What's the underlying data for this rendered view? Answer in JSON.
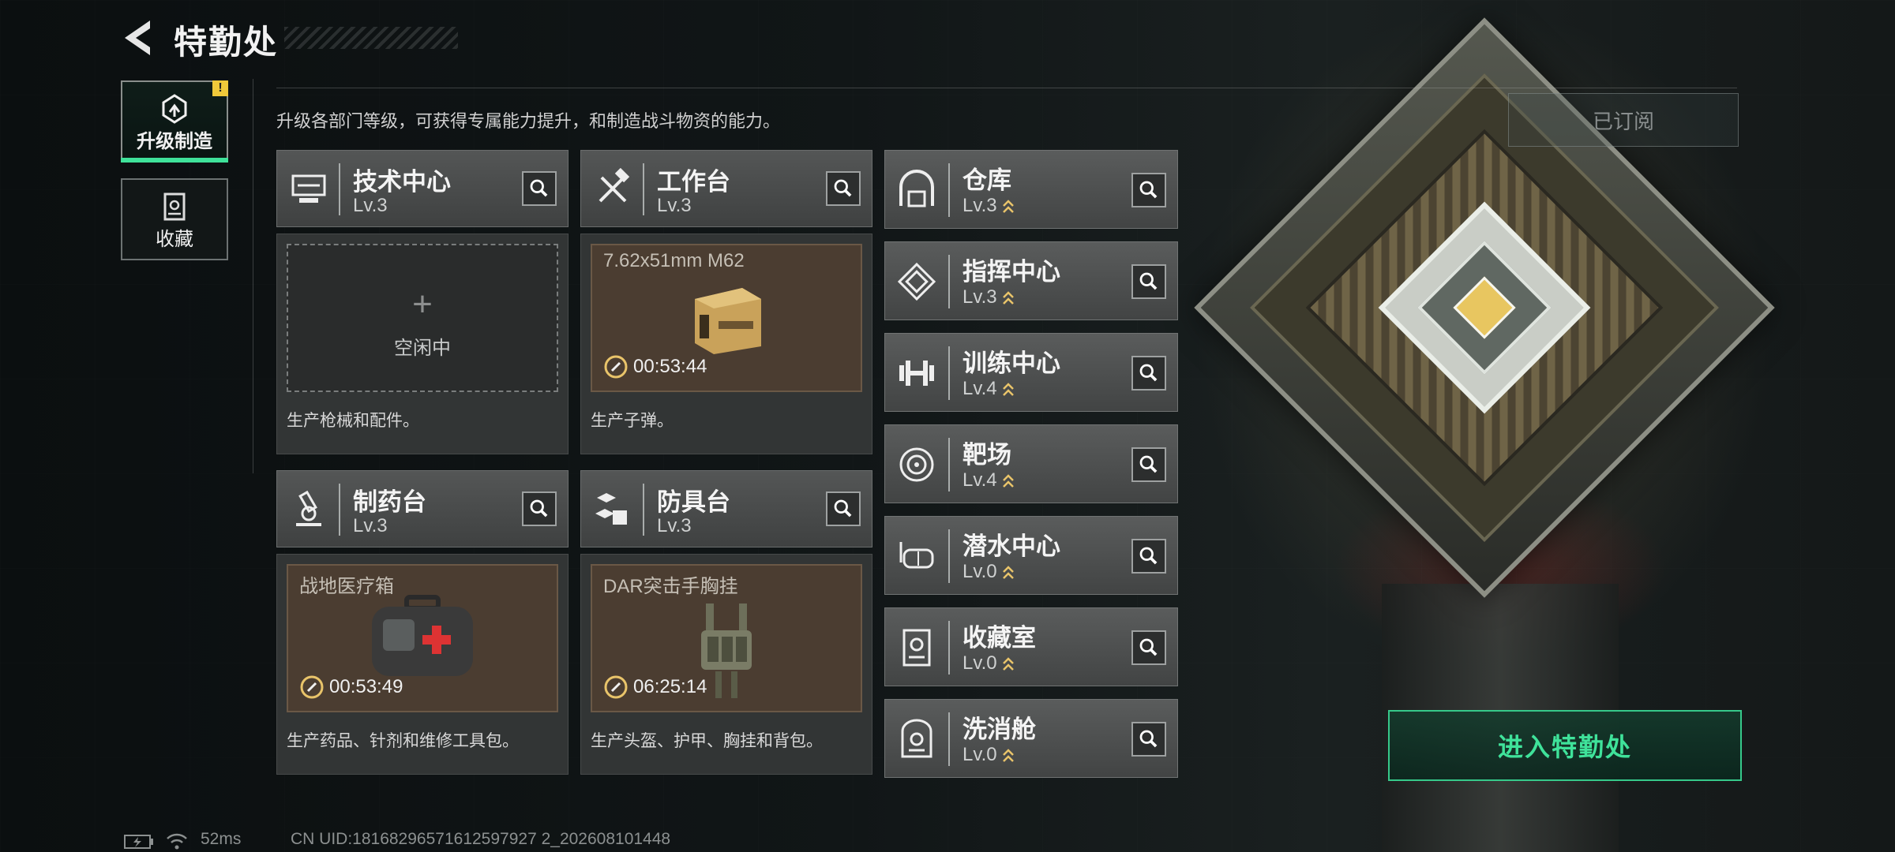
{
  "header": {
    "title": "特勤处"
  },
  "sidebar": {
    "items": [
      {
        "label": "升级制造",
        "active": true,
        "badge": "!"
      },
      {
        "label": "收藏",
        "active": false
      }
    ]
  },
  "subtitle": "升级各部门等级，可获得专属能力提升，和制造战斗物资的能力。",
  "subscribed_button": "已订阅",
  "cards": [
    {
      "name": "技术中心",
      "level": "Lv.3",
      "icon": "tech-center-icon",
      "slot": {
        "state": "idle",
        "plus": "+",
        "label": "空闲中"
      },
      "desc": "生产枪械和配件。"
    },
    {
      "name": "工作台",
      "level": "Lv.3",
      "icon": "hammer-wrench-icon",
      "slot": {
        "state": "producing",
        "item": "7.62x51mm M62",
        "time": "00:53:44",
        "item_icon": "ammo-box-icon"
      },
      "desc": "生产子弹。"
    },
    {
      "name": "制药台",
      "level": "Lv.3",
      "icon": "microscope-icon",
      "slot": {
        "state": "producing",
        "item": "战地医疗箱",
        "time": "00:53:49",
        "item_icon": "medkit-icon"
      },
      "desc": "生产药品、针剂和维修工具包。"
    },
    {
      "name": "防具台",
      "level": "Lv.3",
      "icon": "armor-blocks-icon",
      "slot": {
        "state": "producing",
        "item": "DAR突击手胸挂",
        "time": "06:25:14",
        "item_icon": "chest-rig-icon"
      },
      "desc": "生产头盔、护甲、胸挂和背包。"
    }
  ],
  "departments": [
    {
      "name": "仓库",
      "level": "Lv.3",
      "icon": "warehouse-icon"
    },
    {
      "name": "指挥中心",
      "level": "Lv.3",
      "icon": "command-center-icon"
    },
    {
      "name": "训练中心",
      "level": "Lv.4",
      "icon": "dumbbell-icon"
    },
    {
      "name": "靶场",
      "level": "Lv.4",
      "icon": "target-icon"
    },
    {
      "name": "潜水中心",
      "level": "Lv.0",
      "icon": "diving-mask-icon"
    },
    {
      "name": "收藏室",
      "level": "Lv.0",
      "icon": "collection-room-icon"
    },
    {
      "name": "洗消舱",
      "level": "Lv.0",
      "icon": "decon-chamber-icon"
    }
  ],
  "enter_button": "进入特勤处",
  "status": {
    "ping": "52ms",
    "uid": "CN UID:18168296571612597927 2_202608101448"
  },
  "colors": {
    "accent": "#3fe29a",
    "upgrade_arrow": "#e9c46a",
    "badge": "#f0c93a"
  }
}
